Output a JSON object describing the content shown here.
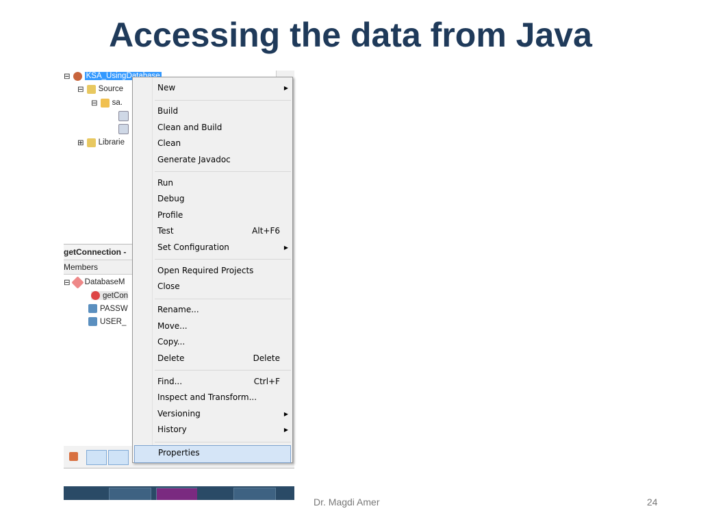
{
  "slide": {
    "title": "Accessing the data from Java",
    "author": "Dr. Magdi Amer",
    "page": "24"
  },
  "projects": {
    "root": "KSA_UsingDatabase",
    "source": "Source",
    "package": "sa.",
    "libraries": "Librarie"
  },
  "navigator": {
    "header": "getConnection -",
    "members_label": "Members",
    "class_name": "DatabaseM",
    "items": [
      "getCon",
      "PASSW",
      "USER_"
    ]
  },
  "menu": {
    "items": [
      {
        "label": "New",
        "arrow": true
      },
      {
        "sep": true
      },
      {
        "label": "Build"
      },
      {
        "label": "Clean and Build"
      },
      {
        "label": "Clean"
      },
      {
        "label": "Generate Javadoc"
      },
      {
        "sep": true
      },
      {
        "label": "Run"
      },
      {
        "label": "Debug"
      },
      {
        "label": "Profile"
      },
      {
        "label": "Test",
        "shortcut": "Alt+F6"
      },
      {
        "label": "Set Configuration",
        "arrow": true
      },
      {
        "sep": true
      },
      {
        "label": "Open Required Projects"
      },
      {
        "label": "Close"
      },
      {
        "sep": true
      },
      {
        "label": "Rename..."
      },
      {
        "label": "Move..."
      },
      {
        "label": "Copy..."
      },
      {
        "label": "Delete",
        "shortcut": "Delete"
      },
      {
        "sep": true
      },
      {
        "label": "Find...",
        "shortcut": "Ctrl+F"
      },
      {
        "label": "Inspect and Transform..."
      },
      {
        "label": "Versioning",
        "arrow": true
      },
      {
        "label": "History",
        "arrow": true
      },
      {
        "sep": true
      },
      {
        "label": "Properties",
        "highlighted": true
      }
    ]
  }
}
